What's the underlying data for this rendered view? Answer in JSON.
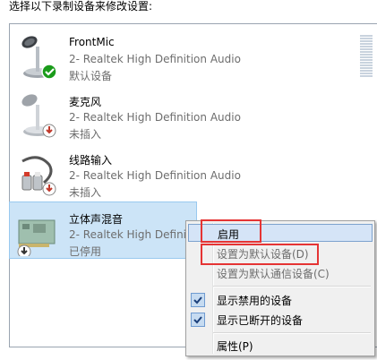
{
  "prompt": "选择以下录制设备来修改设置:",
  "devices": [
    {
      "name": "FrontMic",
      "driver": "2- Realtek High Definition Audio",
      "status": "默认设备",
      "icon": "microphone-default-icon"
    },
    {
      "name": "麦克风",
      "driver": "2- Realtek High Definition Audio",
      "status": "未插入",
      "icon": "microphone-unplugged-icon"
    },
    {
      "name": "线路输入",
      "driver": "2- Realtek High Definition Audio",
      "status": "未插入",
      "icon": "line-in-cable-icon"
    },
    {
      "name": "立体声混音",
      "driver": "2- Realtek High Definiti",
      "status": "已停用",
      "icon": "sound-card-disabled-icon"
    }
  ],
  "context_menu": {
    "enable": "启用",
    "set_default": "设置为默认设备(D)",
    "set_default_comm": "设置为默认通信设备(C)",
    "show_disabled": "显示禁用的设备",
    "show_disconnected": "显示已断开的设备",
    "properties": "属性(P)"
  },
  "colors": {
    "highlight": "#cce4f7",
    "annotation_red": "#e53434",
    "default_badge": "#1a9b1a",
    "unplugged_badge": "#c0392b"
  }
}
